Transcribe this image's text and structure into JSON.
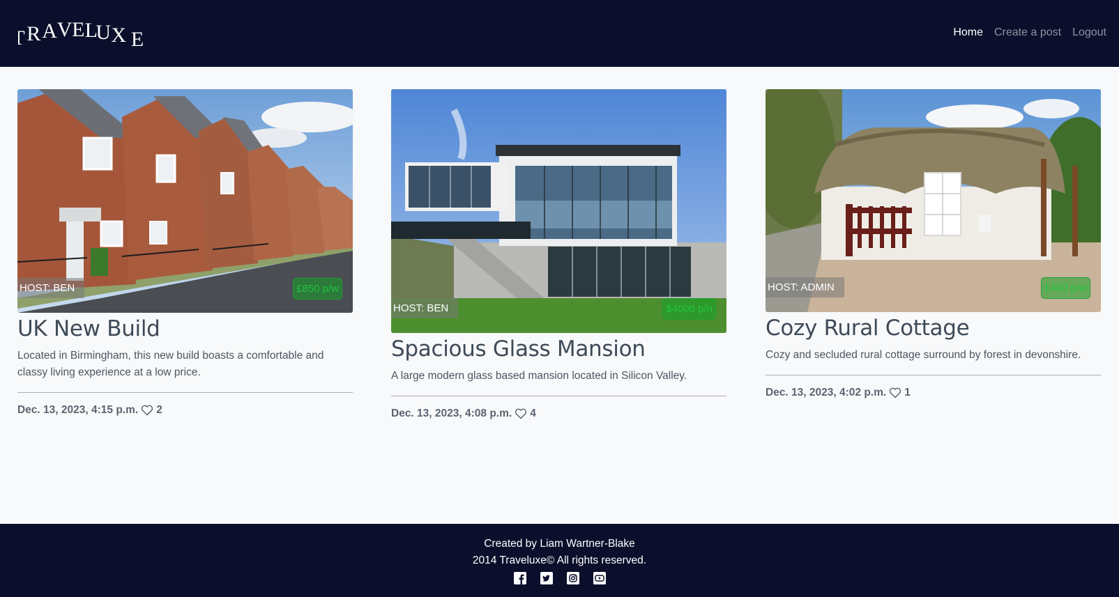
{
  "brand": {
    "logo_text": "TRAVELUXE"
  },
  "nav": {
    "home": "Home",
    "create_post": "Create a post",
    "logout": "Logout"
  },
  "posts": [
    {
      "title": "UK New Build",
      "description": "Located in Birmingham, this new build boasts a comfortable and classy living experience at a low price.",
      "host": "HOST: BEN",
      "price": "£850 p/w",
      "date": "Dec. 13, 2023, 4:15 p.m.",
      "likes": "2",
      "image_icon": "terraced-houses-photo"
    },
    {
      "title": "Spacious Glass Mansion",
      "description": "A large modern glass based mansion located in Silicon Valley.",
      "host": "HOST: BEN",
      "price": "$4000 p/n",
      "date": "Dec. 13, 2023, 4:08 p.m.",
      "likes": "4",
      "image_icon": "glass-mansion-photo"
    },
    {
      "title": "Cozy Rural Cottage",
      "description": "Cozy and secluded rural cottage surround by forest in devonshire.",
      "host": "HOST: ADMIN",
      "price": "£400 p/w",
      "date": "Dec. 13, 2023, 4:02 p.m.",
      "likes": "1",
      "image_icon": "thatched-cottage-photo"
    }
  ],
  "footer": {
    "credit": "Created by Liam Wartner-Blake",
    "copyright": "2014 Traveluxe© All rights reserved.",
    "social_icons": [
      "facebook-icon",
      "twitter-icon",
      "instagram-icon",
      "youtube-icon"
    ]
  },
  "colors": {
    "navbar_bg": "#0b0f2b",
    "page_bg": "#f8f9fa",
    "price_green": "#22c33e",
    "text_dark": "#3e4a57"
  }
}
